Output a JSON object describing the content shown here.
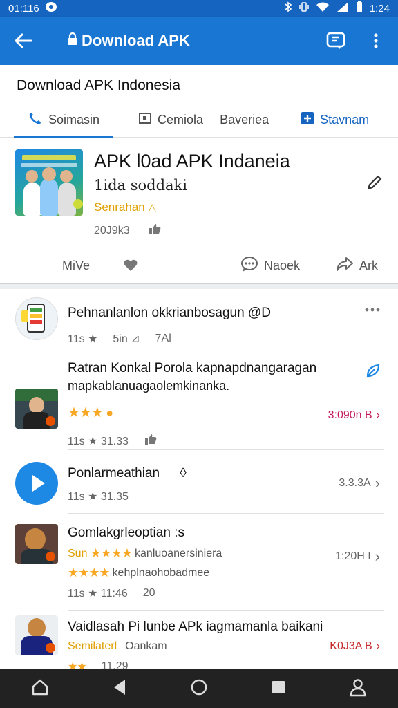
{
  "status_bar": {
    "time_left": "01:116",
    "time_right": "1:24"
  },
  "app_bar": {
    "title": "Download APK",
    "icons": [
      "back-arrow-icon",
      "lock-icon",
      "message-icon",
      "more-vertical-icon"
    ]
  },
  "header": {
    "page_title": "Download APK Indonesia",
    "tabs": [
      {
        "label": "Soimasin",
        "icon": "phone-icon"
      },
      {
        "label": "Cemiola",
        "icon": "frame-icon"
      },
      {
        "label": "Baveriea",
        "icon": ""
      },
      {
        "label": "Stavnam",
        "icon": "add-box-icon"
      }
    ]
  },
  "card": {
    "title": "APK l0ad APK Indaneia",
    "subtitle": "1ida soddaki",
    "rating_text": "Senrahan",
    "meta": "20J9k3",
    "actions": [
      {
        "label": "MiVe",
        "icon": ""
      },
      {
        "label": "",
        "icon": "like-icon"
      },
      {
        "label": "Naoek",
        "icon": "comment-icon"
      },
      {
        "label": "Ark",
        "icon": "share-icon"
      }
    ]
  },
  "list": {
    "items": [
      {
        "title": "Pehnanlanlon okkrianbosagun @D",
        "meta_a": "11s",
        "meta_b": "5in",
        "meta_c": "7Al"
      },
      {
        "title_line1": "Ratran Konkal Porola kapnapdnangaragan",
        "title_line2": "mapkablanuagaolemkinanka.",
        "meta_a": "11s",
        "meta_b": "31.33",
        "right_text": "3:090n B"
      },
      {
        "title": "Ponlarmeathian",
        "meta_a": "11s",
        "meta_b": "31.35",
        "right_text": "3.3.3A"
      },
      {
        "title": "Gomlakgrleoptian :s",
        "line2": "kanluoanersiniera",
        "line2_prefix": "Sun",
        "line3": "kehplnaohobadmee",
        "meta_a": "11s",
        "meta_b": "11:46",
        "meta_c": "20",
        "right_text": "1:20H I"
      },
      {
        "title": "Vaidlasah Pi lunbe APk iagmamanla baikani",
        "line2_a": "Semilaterl",
        "line2_b": "Oankam",
        "meta_b": "11.29",
        "right_text": "K0J3A B"
      }
    ]
  },
  "colors": {
    "primary": "#1976d2",
    "status_bar": "#1565c0",
    "star": "#f9a825",
    "accent_red": "#d81b60"
  }
}
